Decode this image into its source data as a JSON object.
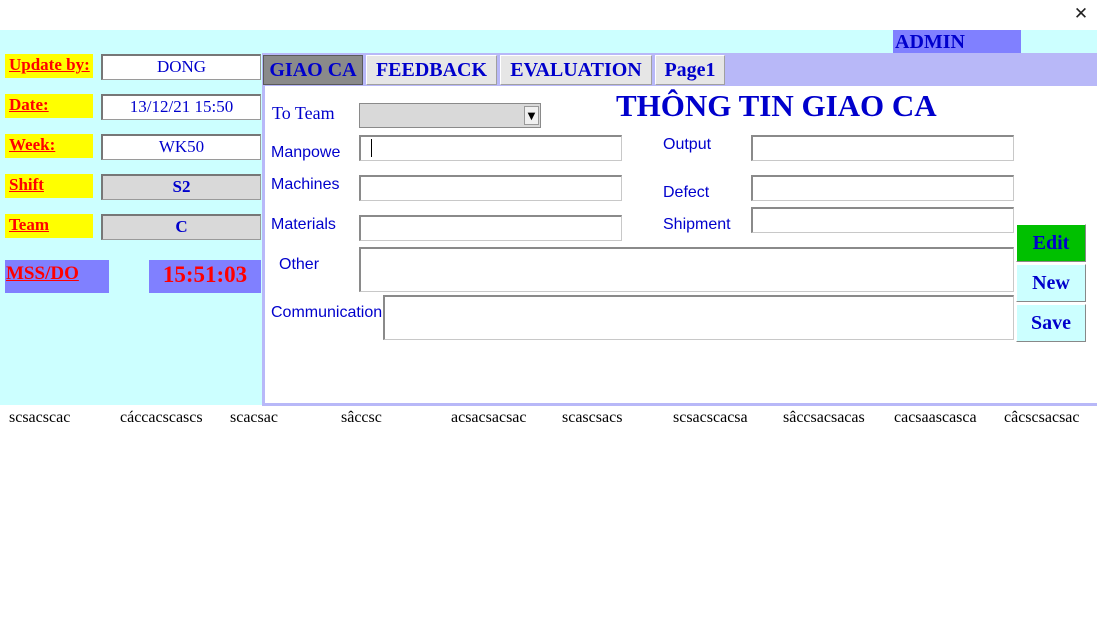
{
  "window": {
    "close_glyph": "✕"
  },
  "header": {
    "admin_label": "ADMIN"
  },
  "left": {
    "update_by": {
      "label": "Update by:",
      "value": "DONG"
    },
    "date": {
      "label": "Date:",
      "value": "13/12/21 15:50"
    },
    "week": {
      "label": "Week:",
      "value": "WK50"
    },
    "shift": {
      "label": "Shift",
      "value": "S2"
    },
    "team": {
      "label": "Team",
      "value": "C"
    },
    "mss_label": "MSS/DO",
    "clock": "15:51:03"
  },
  "tabs": [
    {
      "label": "GIAO CA",
      "active": true
    },
    {
      "label": "FEEDBACK",
      "active": false
    },
    {
      "label": "EVALUATION",
      "active": false
    },
    {
      "label": "Page1",
      "active": false
    }
  ],
  "form": {
    "title": "THÔNG TIN GIAO CA",
    "to_team": {
      "label": "To Team",
      "value": ""
    },
    "manpower": {
      "label": "Manpowe",
      "value": ""
    },
    "machines": {
      "label": "Machines",
      "value": ""
    },
    "materials": {
      "label": "Materials",
      "value": ""
    },
    "output": {
      "label": "Output",
      "value": ""
    },
    "defect": {
      "label": "Defect",
      "value": ""
    },
    "shipment": {
      "label": "Shipment",
      "value": ""
    },
    "other": {
      "label": "Other",
      "value": ""
    },
    "communication": {
      "label": "Communication",
      "value": ""
    }
  },
  "buttons": {
    "edit": "Edit",
    "new": "New",
    "save": "Save"
  },
  "list_row": [
    "scsacscac",
    "cáccacscascs",
    "scacsac",
    "sâccsc",
    "acsacsacsac",
    "scascsacs",
    "scsacscacsa",
    "sâccsacsacas",
    "cacsaascasca",
    "câcscsacsac"
  ],
  "colors": {
    "cyan_bg": "#ccffff",
    "tab_bar": "#b8b8f8",
    "label_yellow": "#ffff00",
    "label_red": "#ff0000",
    "text_blue": "#0000cc",
    "purple": "#8080ff",
    "edit_green": "#00c000"
  }
}
